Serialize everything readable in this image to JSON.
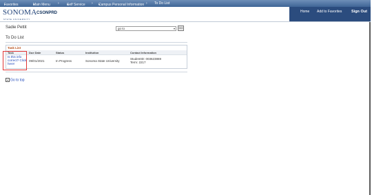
{
  "topnav": {
    "favorites": "Favorites",
    "main_menu": "Main Menu",
    "self_service": "Self Service",
    "campus_personal": "Campus Personal Information",
    "to_do_list": "To Do List"
  },
  "header": {
    "logo": "SONOMA",
    "logo_sub": "STATE UNIVERSITY",
    "system": "CSONPRD",
    "home": "Home",
    "add_favorites": "Add to Favorites",
    "sign_out": "Sign Out"
  },
  "page": {
    "student_name": "Sadie Pettit",
    "goto_value": "go to",
    "go_button": "GO",
    "title": "To Do List"
  },
  "task_list": {
    "title": "Task List",
    "columns": [
      "Task",
      "Due Date",
      "Status",
      "Institution",
      "Contact Information"
    ],
    "row": {
      "task": "Is this info correct? Click here!",
      "due_date": "09/01/2021",
      "status": "In Progress",
      "institution": "Sonoma State University",
      "contact_line1": "StudentID: 003623869",
      "contact_line2": "Term: 2217"
    }
  },
  "footer": {
    "go_to_top": "Go to top"
  }
}
